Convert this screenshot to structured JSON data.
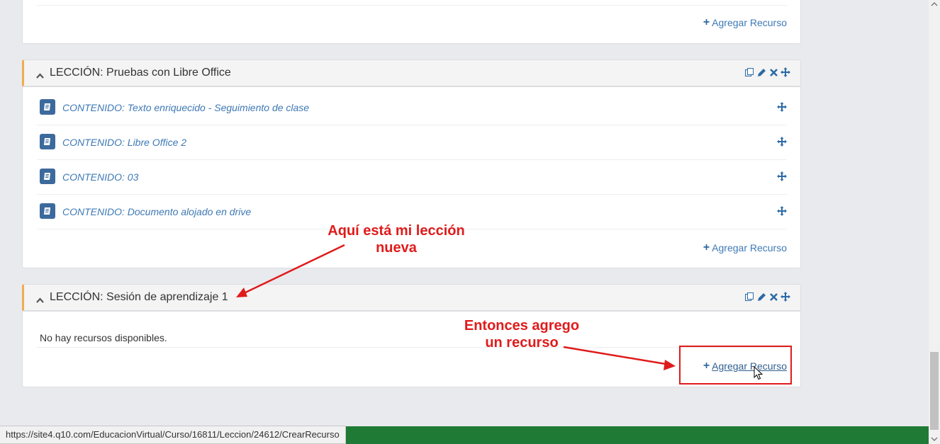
{
  "top_panel": {
    "add_resource": "Agregar Recurso"
  },
  "lesson1": {
    "title": "LECCIÓN: Pruebas con Libre Office",
    "resources": [
      "CONTENIDO: Texto enriquecido - Seguimiento de clase",
      "CONTENIDO: Libre Office 2",
      "CONTENIDO: 03",
      "CONTENIDO: Documento alojado en drive"
    ],
    "add_resource": "Agregar Recurso"
  },
  "lesson2": {
    "title": "LECCIÓN: Sesión de aprendizaje 1",
    "empty_text": "No hay recursos disponibles.",
    "add_resource": "Agregar Recurso"
  },
  "annotations": {
    "new_lesson_line1": "Aquí está mi lección",
    "new_lesson_line2": "nueva",
    "add_line1": "Entonces agrego",
    "add_line2": "un recurso"
  },
  "status_url": "https://site4.q10.com/EducacionVirtual/Curso/16811/Leccion/24612/CrearRecurso",
  "colors": {
    "accent": "#f0ad4e",
    "link": "#3e79b5",
    "annotation": "#e01b1b",
    "footer": "#1e7a35"
  },
  "icons": [
    "chevron-up-icon",
    "copy-icon",
    "pencil-icon",
    "close-icon",
    "move-icon",
    "book-icon",
    "plus-icon",
    "cursor-icon"
  ]
}
